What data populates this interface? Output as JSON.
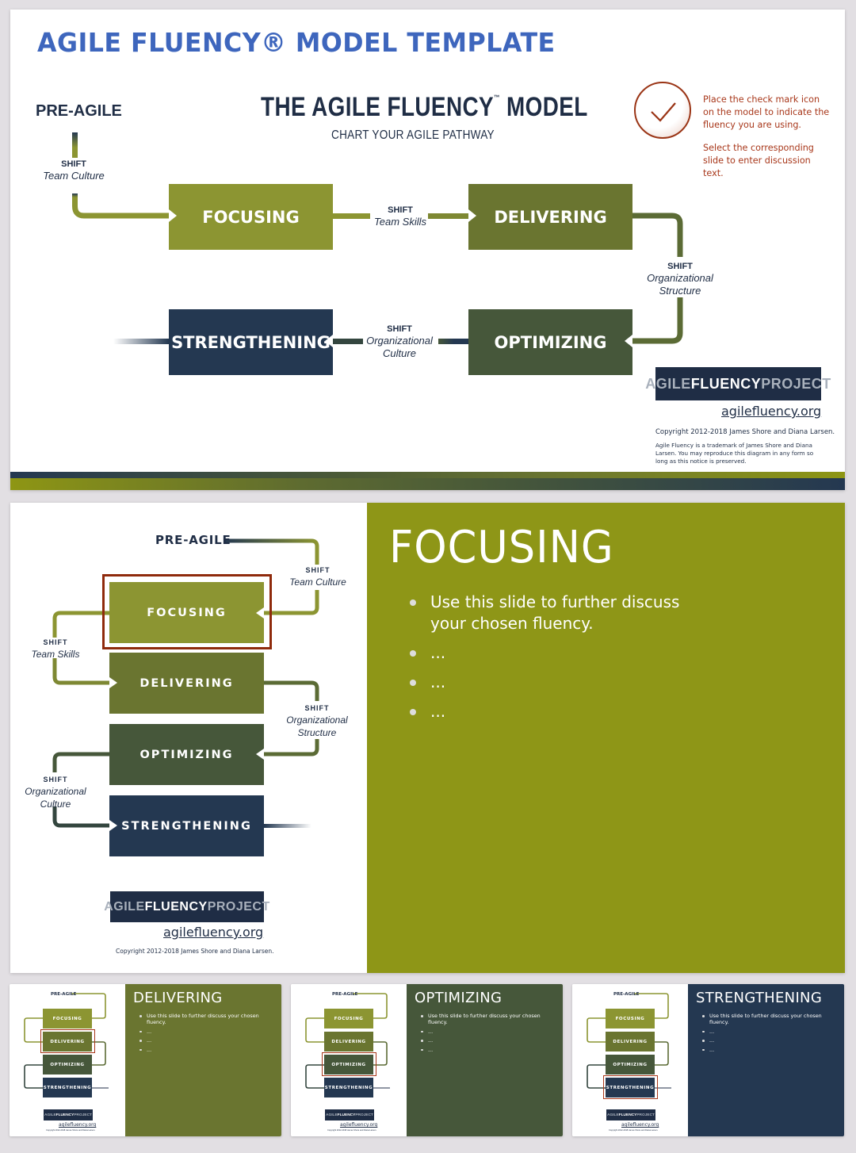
{
  "page_title": "AGILE FLUENCY® MODEL TEMPLATE",
  "colors": {
    "title_blue": "#3e66bd",
    "navy": "#1f2d45",
    "focusing": "#8c9532",
    "delivering": "#6a7530",
    "optimizing": "#46573a",
    "strengthening": "#243851",
    "accent_red": "#8f2a0c",
    "focusing_panel": "#8e9617"
  },
  "slide1": {
    "model_title": "THE AGILE FLUENCY",
    "model_title_tm": "™",
    "model_title_end": " MODEL",
    "model_subtitle": "CHART YOUR AGILE PATHWAY",
    "pre_agile": "PRE-AGILE",
    "shifts": {
      "team_culture": {
        "shift": "SHIFT",
        "name": "Team Culture"
      },
      "team_skills": {
        "shift": "SHIFT",
        "name": "Team Skills"
      },
      "org_structure": {
        "shift": "SHIFT",
        "name_line1": "Organizational",
        "name_line2": "Structure"
      },
      "org_culture": {
        "shift": "SHIFT",
        "name_line1": "Organizational",
        "name_line2": "Culture"
      }
    },
    "zones": {
      "focusing": "FOCUSING",
      "delivering": "DELIVERING",
      "optimizing": "OPTIMIZING",
      "strengthening": "STRENGTHENING"
    },
    "check_icon": "check-mark-icon",
    "instructions": [
      "Place the check mark icon on the model to indicate the fluency you are using.",
      "Select the corresponding slide to enter discussion text."
    ],
    "logo": {
      "part1": "AGILE ",
      "part2": "FLUENCY",
      "part3": " PROJECT"
    },
    "url": "agilefluency.org",
    "copyright": "Copyright 2012-2018 James Shore and Diana Larsen.",
    "notice": "Agile Fluency is a trademark of James Shore and Diana Larsen. You may reproduce this diagram in any form so long as this notice is preserved."
  },
  "slide2": {
    "heading": "FOCUSING",
    "bullets": [
      "Use this slide to further discuss your chosen fluency.",
      "...",
      "...",
      "..."
    ],
    "selected_zone": "FOCUSING",
    "pre_agile": "PRE-AGILE",
    "shifts": {
      "team_culture": {
        "shift": "SHIFT",
        "name": "Team Culture"
      },
      "team_skills": {
        "shift": "SHIFT",
        "name": "Team Skills"
      },
      "org_structure": {
        "shift": "SHIFT",
        "name_line1": "Organizational",
        "name_line2": "Structure"
      },
      "org_culture": {
        "shift": "SHIFT",
        "name_line1": "Organizational",
        "name_line2": "Culture"
      }
    },
    "zones": [
      "FOCUSING",
      "DELIVERING",
      "OPTIMIZING",
      "STRENGTHENING"
    ],
    "logo": {
      "part1": "AGILE ",
      "part2": "FLUENCY",
      "part3": " PROJECT"
    },
    "url": "agilefluency.org",
    "copyright": "Copyright 2012-2018 James Shore and Diana Larsen."
  },
  "thumbnails": [
    {
      "heading": "DELIVERING",
      "bullets": [
        "Use this slide to further discuss your chosen fluency.",
        "...",
        "...",
        "..."
      ],
      "selected_zone": "DELIVERING",
      "panel_color": "#6a7530"
    },
    {
      "heading": "OPTIMIZING",
      "bullets": [
        "Use this slide to further discuss your chosen fluency.",
        "...",
        "...",
        "..."
      ],
      "selected_zone": "OPTIMIZING",
      "panel_color": "#46573a"
    },
    {
      "heading": "STRENGTHENING",
      "bullets": [
        "Use this slide to further discuss your chosen fluency.",
        "...",
        "...",
        "..."
      ],
      "selected_zone": "STRENGTHENING",
      "panel_color": "#243851"
    }
  ],
  "thumb_mini": {
    "pre_agile": "PRE-AGILE",
    "zones": [
      "FOCUSING",
      "DELIVERING",
      "OPTIMIZING",
      "STRENGTHENING"
    ],
    "logo_part1": "AGILE ",
    "logo_part2": "FLUENCY",
    "logo_part3": " PROJECT",
    "url": "agilefluency.org",
    "copyright": "Copyright 2012-2018 James Shore and Diana Larsen."
  }
}
